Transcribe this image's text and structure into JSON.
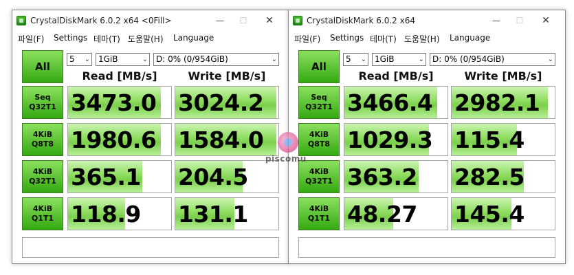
{
  "windows": [
    {
      "title": "CrystalDiskMark 6.0.2 x64  <0Fill>",
      "menu": [
        "파일(F)",
        "Settings",
        "테마(T)",
        "도움말(H)",
        "Language"
      ],
      "all_label": "All",
      "count": "5",
      "size": "1GiB",
      "drive": "D: 0% (0/954GiB)",
      "read_header": "Read [MB/s]",
      "write_header": "Write [MB/s]",
      "rows": [
        {
          "label1": "Seq",
          "label2": "Q32T1",
          "read": "3473.0",
          "write": "3024.2",
          "read_fill": 0.9,
          "write_fill": 0.98
        },
        {
          "label1": "4KiB",
          "label2": "Q8T8",
          "read": "1980.6",
          "write": "1584.0",
          "read_fill": 0.9,
          "write_fill": 0.98
        },
        {
          "label1": "4KiB",
          "label2": "Q32T1",
          "read": "365.1",
          "write": "204.5",
          "read_fill": 0.72,
          "write_fill": 0.65
        },
        {
          "label1": "4KiB",
          "label2": "Q1T1",
          "read": "118.9",
          "write": "131.1",
          "read_fill": 0.55,
          "write_fill": 0.57
        }
      ],
      "comment": ""
    },
    {
      "title": "CrystalDiskMark 6.0.2 x64",
      "menu": [
        "파일(F)",
        "Settings",
        "테마(T)",
        "도움말(H)",
        "Language"
      ],
      "all_label": "All",
      "count": "5",
      "size": "1GiB",
      "drive": "D: 0% (0/954GiB)",
      "read_header": "Read [MB/s]",
      "write_header": "Write [MB/s]",
      "rows": [
        {
          "label1": "Seq",
          "label2": "Q32T1",
          "read": "3466.4",
          "write": "2982.1",
          "read_fill": 0.9,
          "write_fill": 0.93
        },
        {
          "label1": "4KiB",
          "label2": "Q8T8",
          "read": "1029.3",
          "write": "115.4",
          "read_fill": 0.82,
          "write_fill": 0.63
        },
        {
          "label1": "4KiB",
          "label2": "Q32T1",
          "read": "363.2",
          "write": "282.5",
          "read_fill": 0.72,
          "write_fill": 0.7
        },
        {
          "label1": "4KiB",
          "label2": "Q1T1",
          "read": "48.27",
          "write": "145.4",
          "read_fill": 0.47,
          "write_fill": 0.58
        }
      ],
      "comment": ""
    }
  ],
  "watermark": "piscomu",
  "colors": {
    "button_top": "#8be05e",
    "button_bottom": "#34a911",
    "bar_fill": "#8edc5f"
  }
}
